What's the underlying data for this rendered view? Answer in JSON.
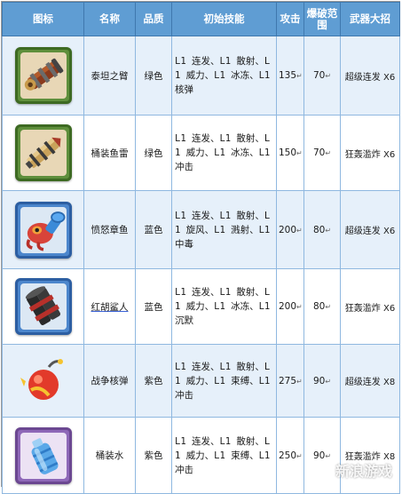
{
  "table": {
    "headers": [
      "图标",
      "名称",
      "品质",
      "初始技能",
      "攻击",
      "爆破范围",
      "武器大招"
    ],
    "rows": [
      {
        "icon": "cannon-icon",
        "name": "泰坦之臂",
        "quality": "绿色",
        "skills": "L1 连发、L1 散射、L1 威力、L1 冰冻、L1 核弹",
        "attack": "135",
        "range": "70",
        "ultimate": "超级连发 X6"
      },
      {
        "icon": "torpedo-tube-icon",
        "name": "桶装鱼雷",
        "quality": "绿色",
        "skills": "L1 连发、L1 散射、L1 威力、L1 冰冻、L1 冲击",
        "attack": "150",
        "range": "70",
        "ultimate": "狂轰滥炸 X6"
      },
      {
        "icon": "octopus-cannon-icon",
        "name": "愤怒章鱼",
        "quality": "蓝色",
        "skills": "L1 连发、L1 散射、L1 旋风、L1 溅射、L1 中毒",
        "attack": "200",
        "range": "80",
        "ultimate": "超级连发 X6"
      },
      {
        "icon": "shark-launcher-icon",
        "name": "红胡鲨人",
        "quality": "蓝色",
        "skills": "L1 连发、L1 散射、L1 威力、L1 冰冻、L1 沉默",
        "attack": "200",
        "range": "80",
        "ultimate": "狂轰滥炸 X6"
      },
      {
        "icon": "nuke-bomb-icon",
        "name": "战争核弹",
        "quality": "紫色",
        "skills": "L1 连发、L1 散射、L1 威力、L1 束缚、L1 冲击",
        "attack": "275",
        "range": "90",
        "ultimate": "超级连发 X8"
      },
      {
        "icon": "water-bottle-icon",
        "name": "桶装水",
        "quality": "紫色",
        "skills": "L1 连发、L1 散射、L1 威力、L1 束缚、L1 冲击",
        "attack": "250",
        "range": "90",
        "ultimate": "狂轰滥炸 X8"
      }
    ]
  },
  "watermark": {
    "text": "新浪游戏",
    "logo": "sina-eye-logo"
  },
  "colors": {
    "header_bg": "#5f9dd3",
    "row_alt_bg": "#e6f0fa",
    "green_frame": "#5f8f3c",
    "blue_frame": "#4c86cc",
    "purple_frame": "#8e68b8"
  }
}
